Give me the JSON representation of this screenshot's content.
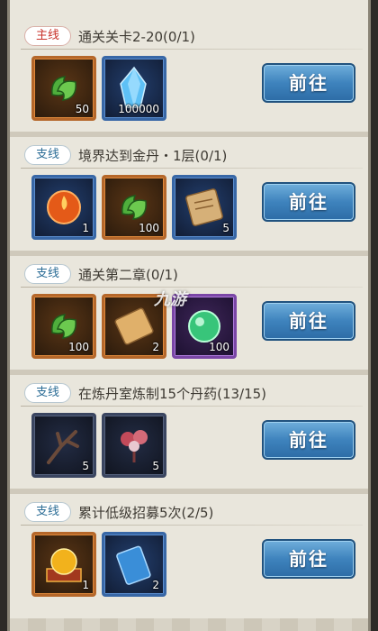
{
  "button_label": "前往",
  "watermark": "九游",
  "quests": [
    {
      "tag": "主线",
      "tag_type": "main",
      "title": "通关关卡2-20(0/1)",
      "rewards": [
        {
          "icon": "jade-pendant-icon",
          "count": "50",
          "frame": "orange"
        },
        {
          "icon": "blue-crystal-icon",
          "count": "100000",
          "frame": "blue"
        }
      ]
    },
    {
      "tag": "支线",
      "tag_type": "side",
      "title": "境界达到金丹・1层(0/1)",
      "rewards": [
        {
          "icon": "fire-orb-icon",
          "count": "1",
          "frame": "blue"
        },
        {
          "icon": "jade-pendant-icon",
          "count": "100",
          "frame": "orange"
        },
        {
          "icon": "scroll-icon",
          "count": "5",
          "frame": "blue"
        }
      ]
    },
    {
      "tag": "支线",
      "tag_type": "side",
      "title": "通关第二章(0/1)",
      "rewards": [
        {
          "icon": "jade-pendant-icon",
          "count": "100",
          "frame": "orange"
        },
        {
          "icon": "scroll-icon",
          "count": "2",
          "frame": "orange"
        },
        {
          "icon": "green-orb-icon",
          "count": "100",
          "frame": "purple"
        }
      ]
    },
    {
      "tag": "支线",
      "tag_type": "side",
      "title": "在炼丹室炼制15个丹药(13/15)",
      "rewards": [
        {
          "icon": "dark-branch-icon",
          "count": "5",
          "frame": "dark"
        },
        {
          "icon": "red-herb-icon",
          "count": "5",
          "frame": "dark"
        }
      ]
    },
    {
      "tag": "支线",
      "tag_type": "side",
      "title": "累计低级招募5次(2/5)",
      "rewards": [
        {
          "icon": "golden-orb-chest-icon",
          "count": "1",
          "frame": "orange"
        },
        {
          "icon": "blue-ticket-icon",
          "count": "2",
          "frame": "blue"
        }
      ]
    }
  ]
}
